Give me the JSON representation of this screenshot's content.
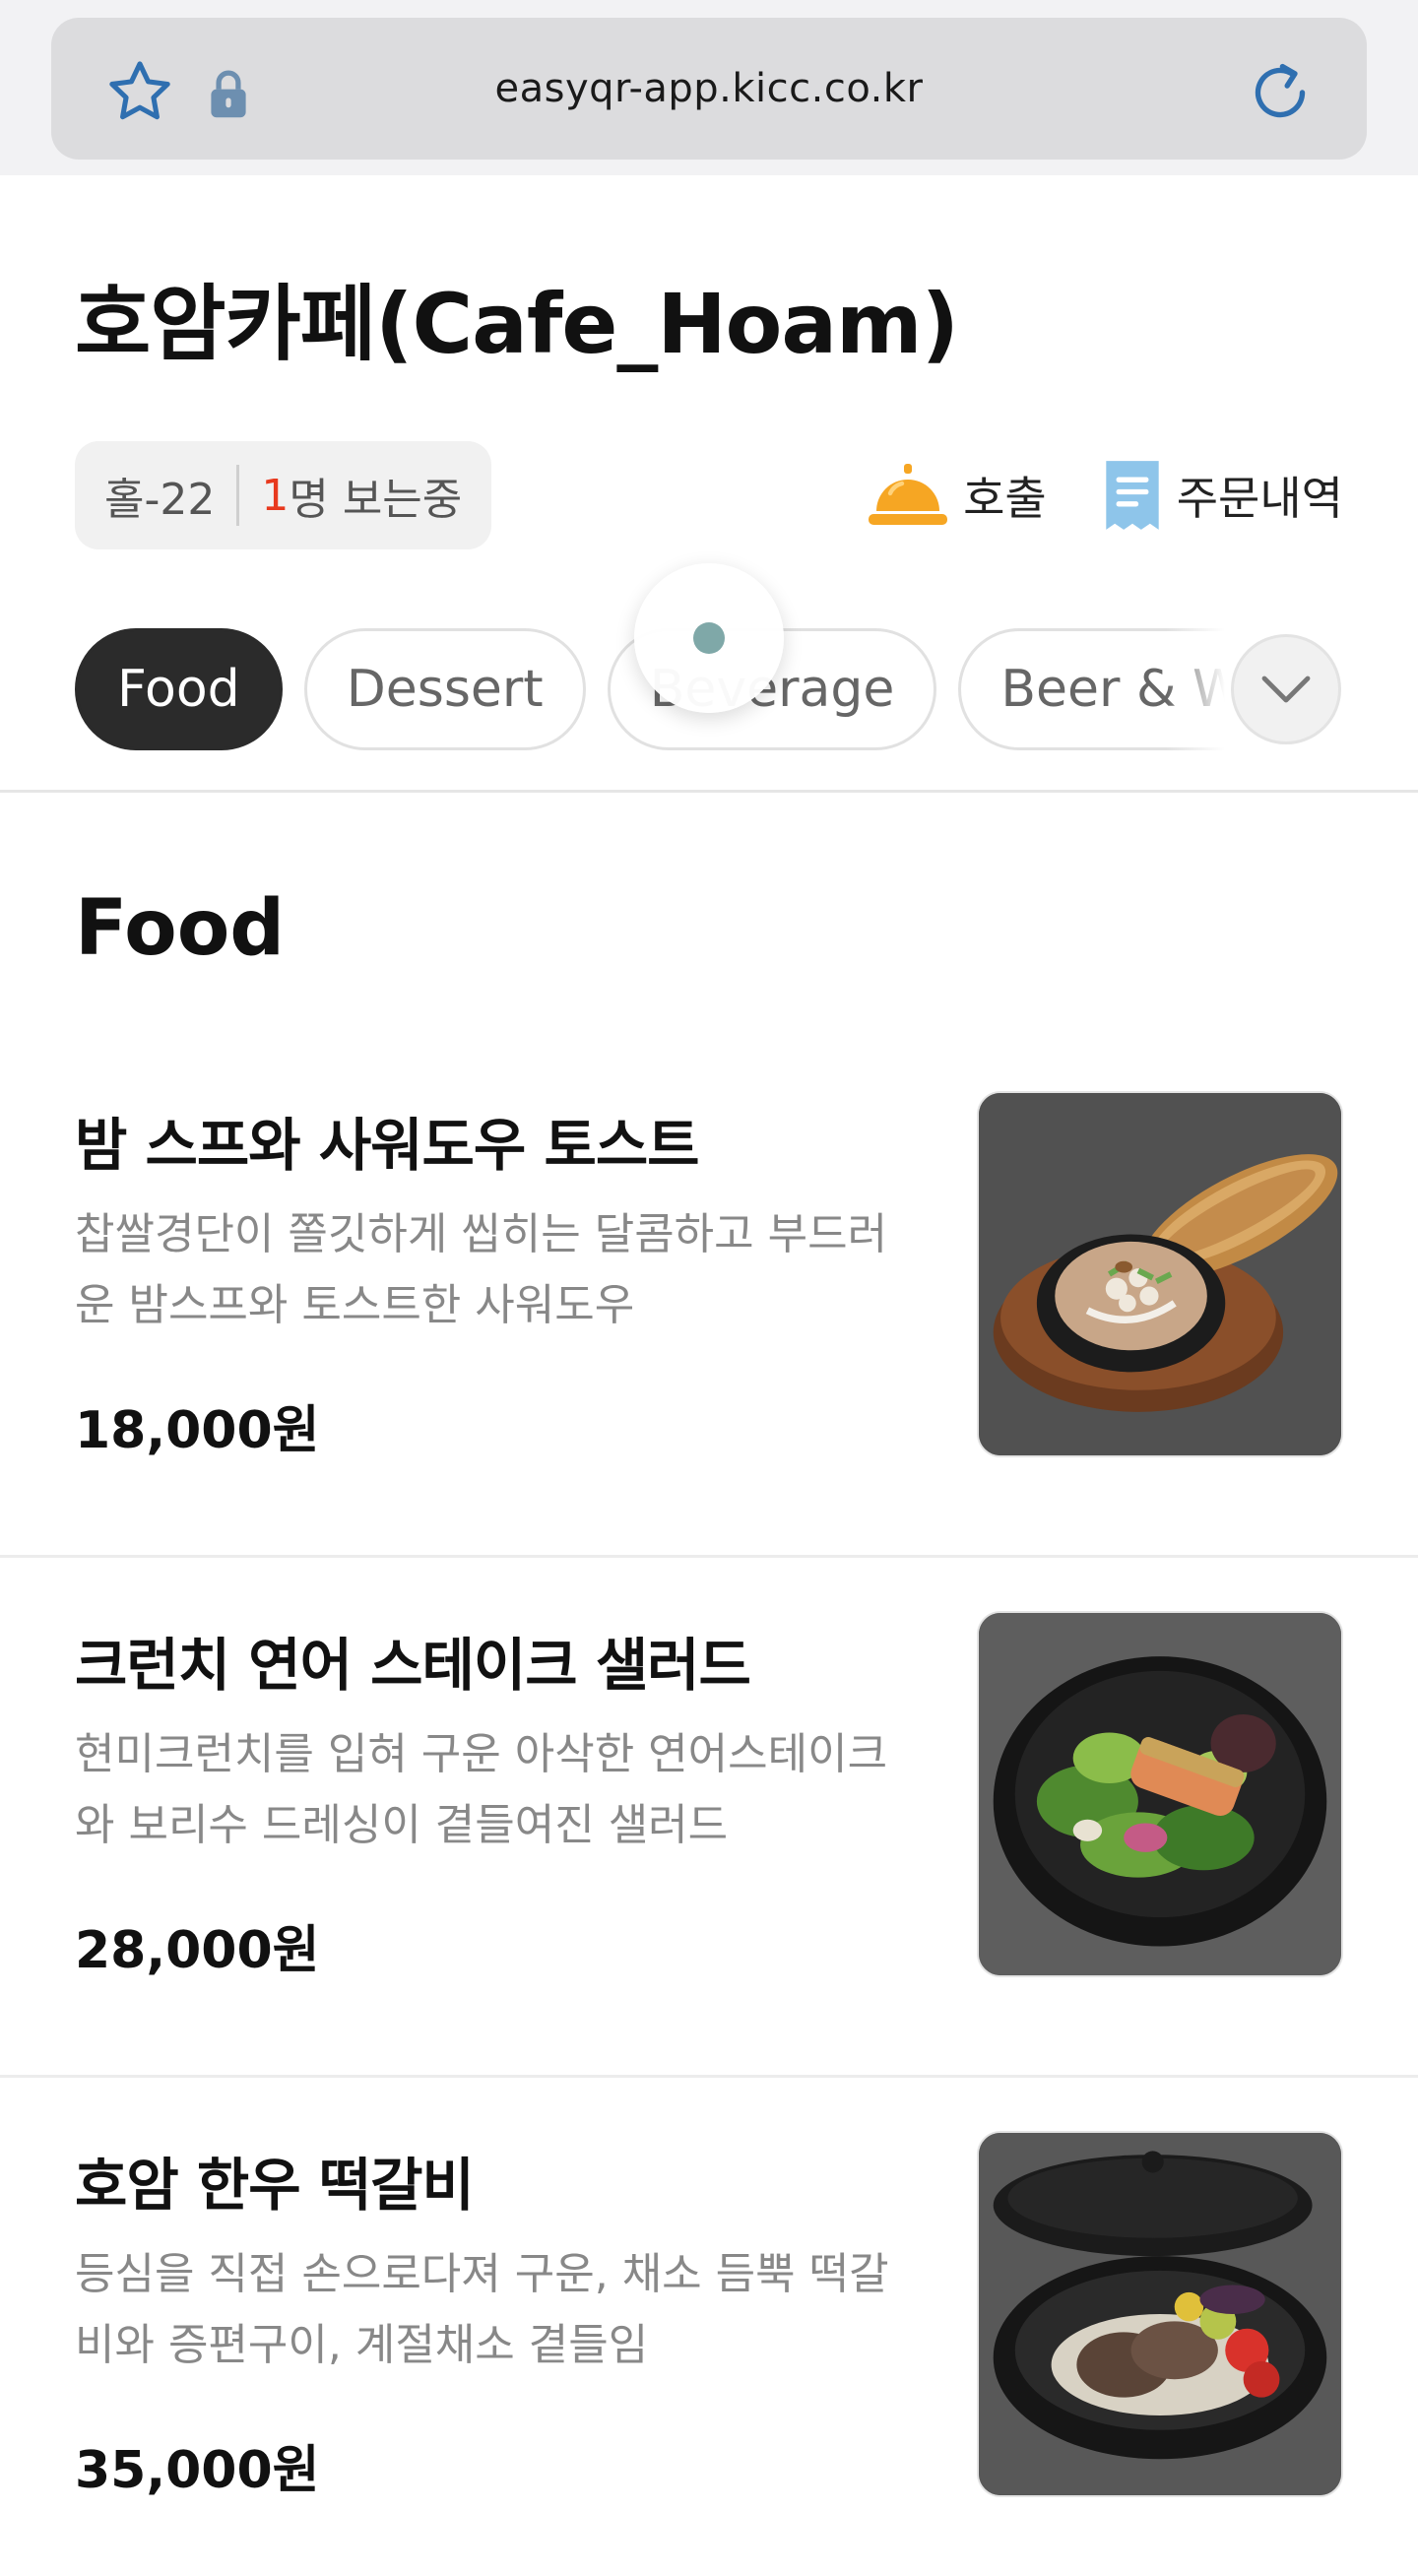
{
  "browser": {
    "url": "easyqr-app.kicc.co.kr"
  },
  "store": {
    "name": "호암카페(Cafe_Hoam)",
    "table": "홀-22",
    "viewers_count": "1",
    "viewers_suffix": "명 보는중",
    "call_label": "호출",
    "orders_label": "주문내역",
    "accent_color": "#e8391e",
    "bell_color": "#f6a623",
    "receipt_color": "#8ec5ea"
  },
  "tabs": [
    {
      "label": "Food",
      "active": true
    },
    {
      "label": "Dessert",
      "active": false
    },
    {
      "label": "Beverage",
      "active": false
    },
    {
      "label": "Beer & Wine",
      "active": false
    }
  ],
  "section": {
    "title": "Food"
  },
  "menu": [
    {
      "name": "밤 스프와 사워도우 토스트",
      "desc": "찹쌀경단이 쫄깃하게 씹히는 달콤하고 부드러운 밤스프와 토스트한 사워도우",
      "price": "18,000원",
      "photo_icon": "chestnut-soup-photo"
    },
    {
      "name": "크런치 연어 스테이크 샐러드",
      "desc": "현미크런치를 입혀 구운 아삭한 연어스테이크와 보리수 드레싱이 곁들여진 샐러드",
      "price": "28,000원",
      "photo_icon": "salmon-salad-photo"
    },
    {
      "name": "호암 한우 떡갈비",
      "desc": "등심을 직접 손으로다져 구운, 채소 듬뿍 떡갈비와 증편구이, 계절채소 곁들임",
      "price": "35,000원",
      "photo_icon": "tteokgalbi-photo"
    }
  ]
}
